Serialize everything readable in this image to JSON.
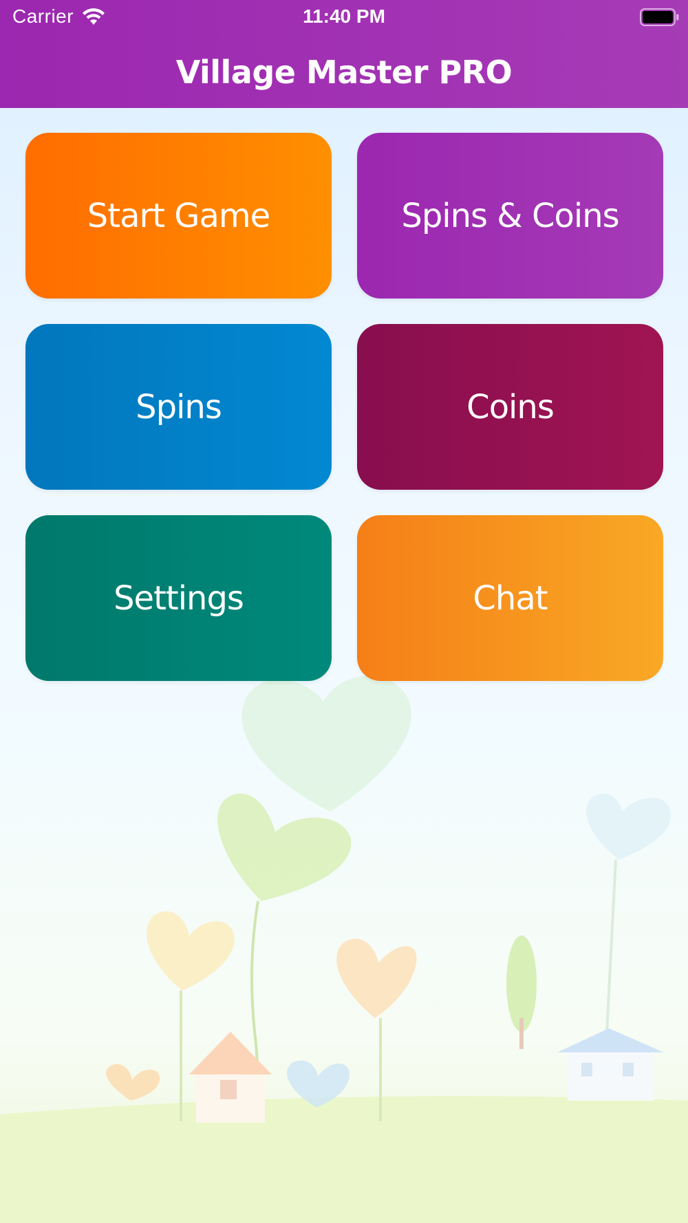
{
  "status_bar": {
    "carrier": "Carrier",
    "time": "11:40 PM",
    "wifi_icon": "wifi-icon",
    "battery_icon": "battery-icon"
  },
  "header": {
    "title": "Village Master PRO",
    "color": "#9c27b0"
  },
  "menu": [
    {
      "label": "Start Game",
      "color": "#ff7a00"
    },
    {
      "label": "Spins & Coins",
      "color": "#9c27b0"
    },
    {
      "label": "Spins",
      "color": "#027fc8"
    },
    {
      "label": "Coins",
      "color": "#8e1050"
    },
    {
      "label": "Settings",
      "color": "#008577"
    },
    {
      "label": "Chat",
      "color": "#f7931e"
    }
  ],
  "background": {
    "theme": "pastel village with heart-shaped trees"
  }
}
